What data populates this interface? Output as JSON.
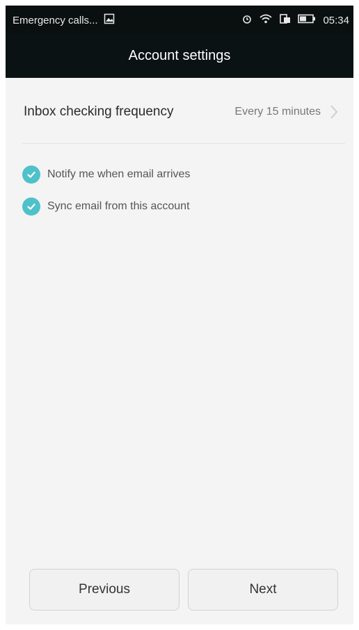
{
  "status_bar": {
    "carrier_text": "Emergency calls...",
    "time": "05:34",
    "icons": [
      "image-icon",
      "alarm-icon",
      "wifi-icon",
      "sim-icon",
      "battery-icon"
    ]
  },
  "header": {
    "title": "Account settings"
  },
  "settings": {
    "inbox_frequency": {
      "label": "Inbox checking frequency",
      "value": "Every 15 minutes"
    },
    "checkboxes": [
      {
        "label": "Notify me when email arrives",
        "checked": true
      },
      {
        "label": "Sync email from this account",
        "checked": true
      }
    ]
  },
  "footer": {
    "previous_label": "Previous",
    "next_label": "Next"
  },
  "colors": {
    "accent": "#4fc1c9",
    "header_bg": "#0b1213",
    "page_bg": "#f4f4f4"
  }
}
